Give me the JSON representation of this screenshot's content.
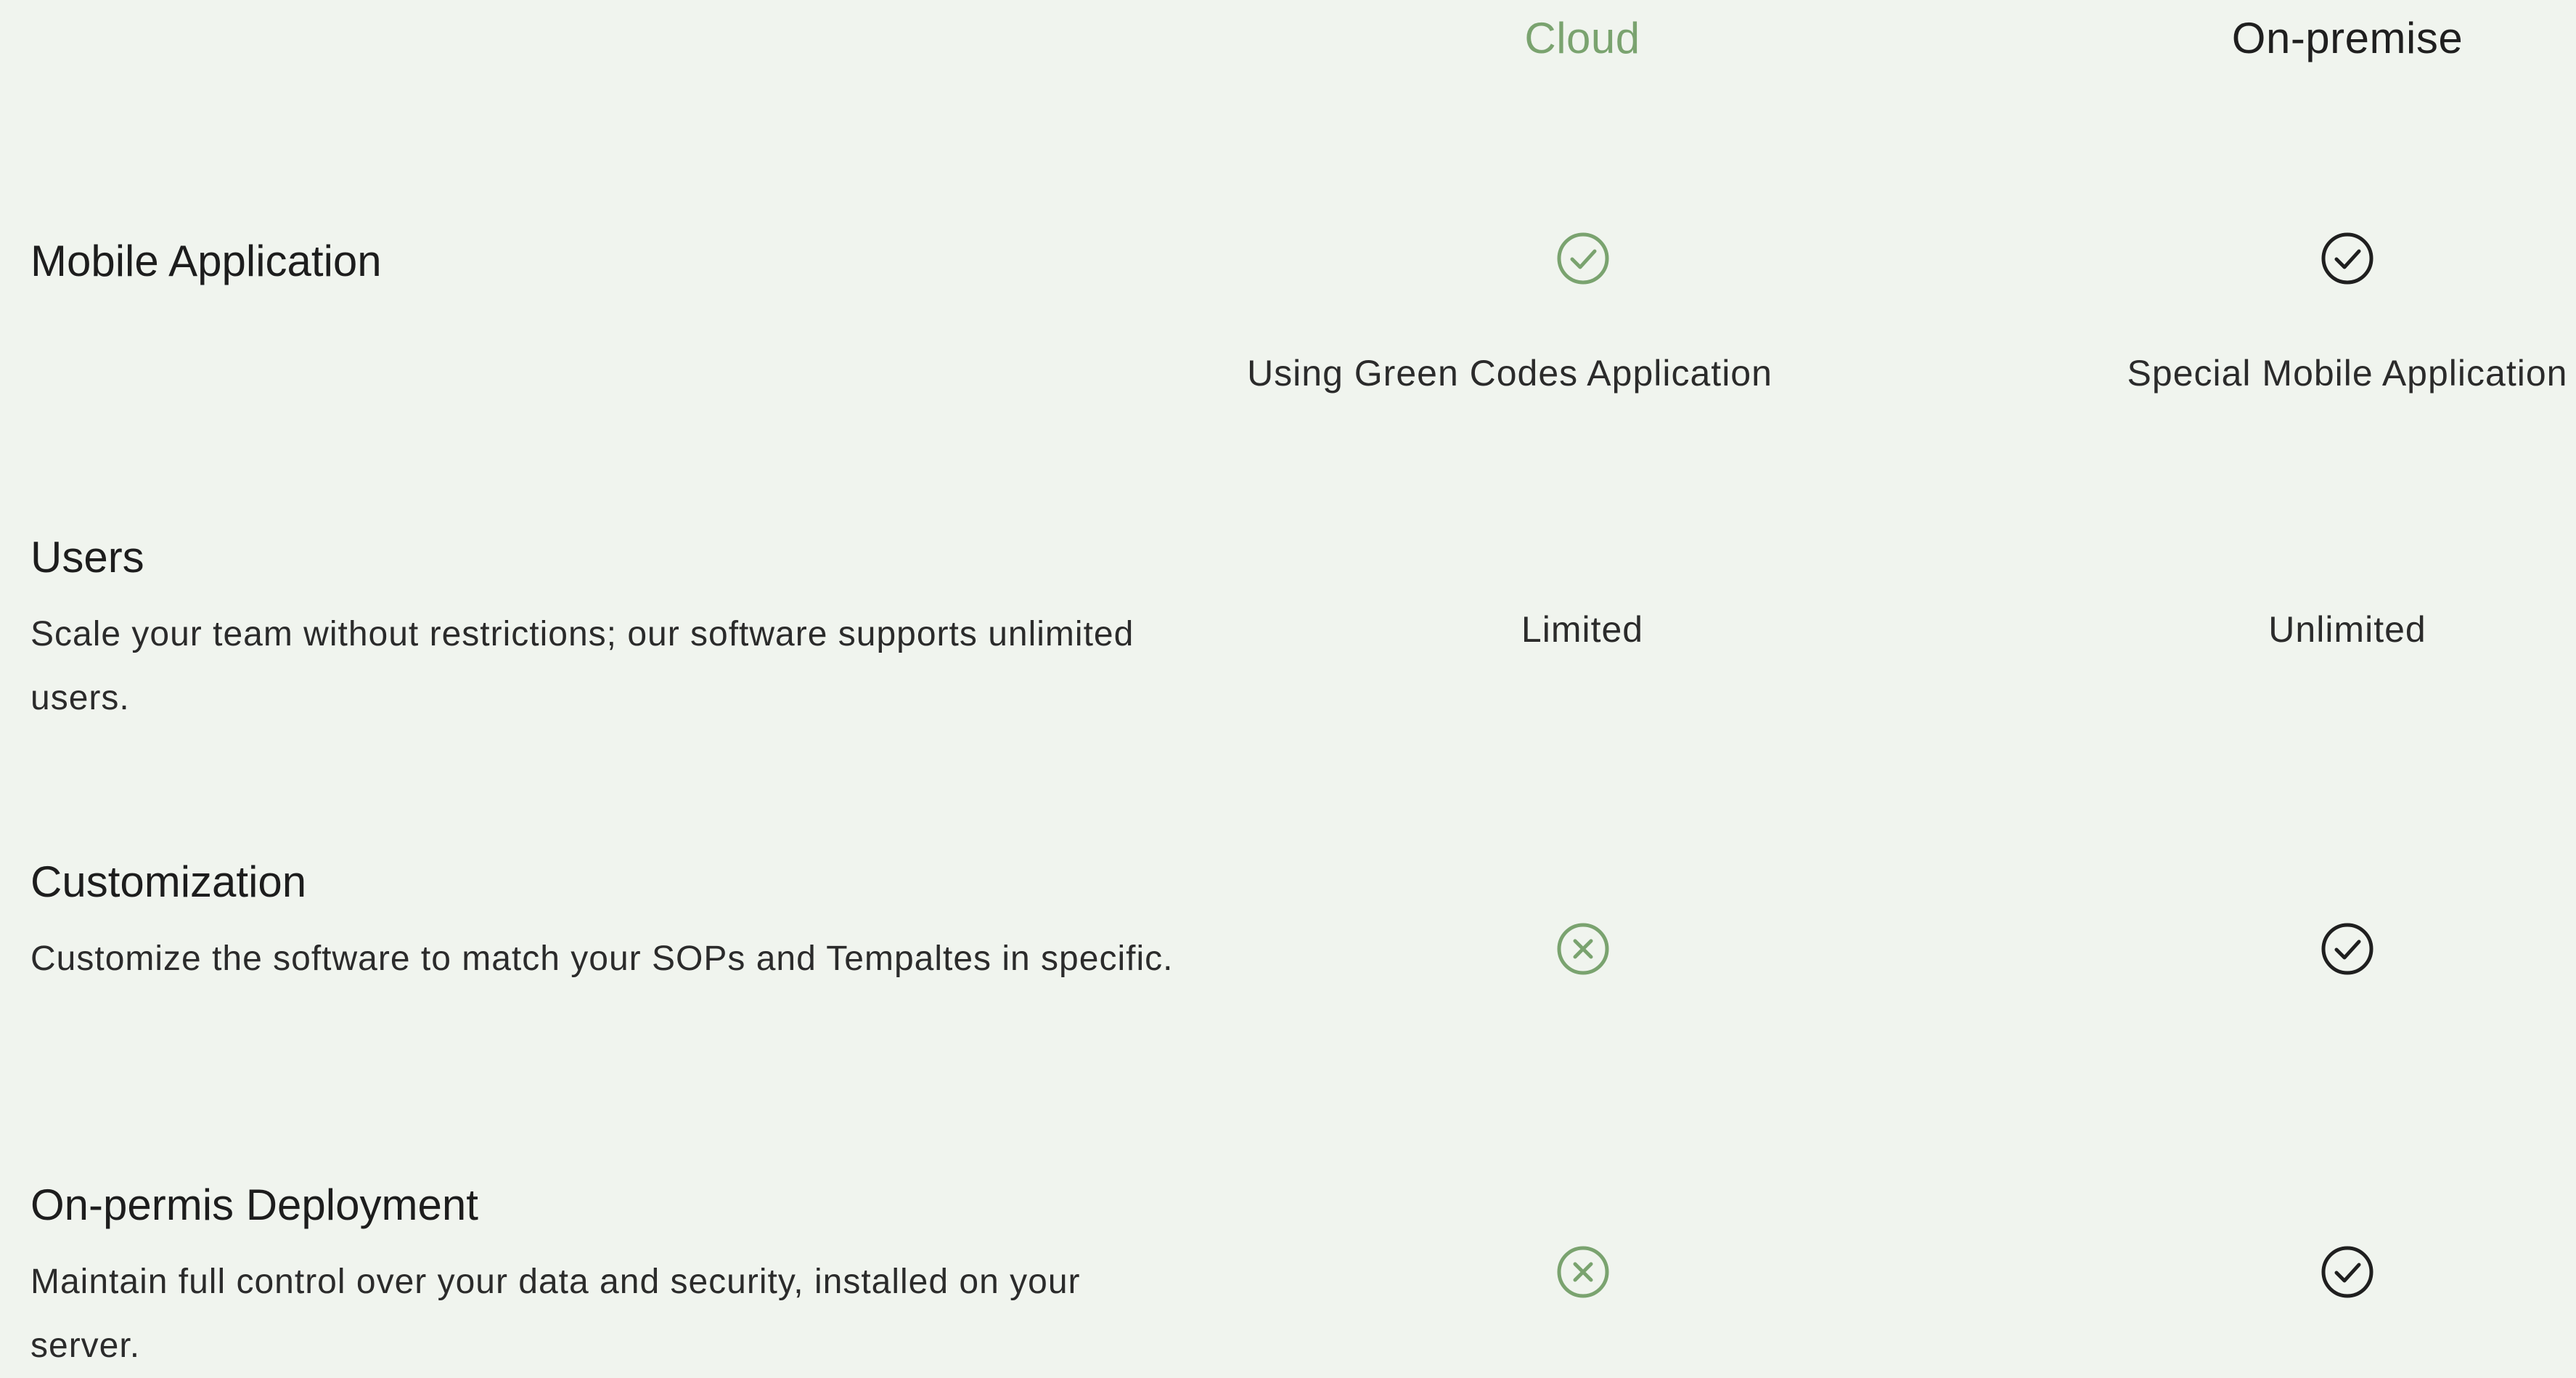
{
  "columns": {
    "cloud": "Cloud",
    "onpremise": "On-premise"
  },
  "colors": {
    "accent": "#7aa36f",
    "text": "#1d1d1d",
    "background": "#f0f4ee"
  },
  "rows": [
    {
      "title": "Mobile Application",
      "description": "",
      "cloud_icon": "check-circle-icon",
      "onprem_icon": "check-circle-icon",
      "cloud_text": "Using Green Codes Application",
      "onprem_text": "Special Mobile Application"
    },
    {
      "title": "Users",
      "description": "Scale your team without restrictions; our software supports unlimited users.",
      "cloud_text": "Limited",
      "onprem_text": "Unlimited"
    },
    {
      "title": "Customization",
      "description": "Customize the software to match your SOPs and Tempaltes in specific.",
      "cloud_icon": "x-circle-icon",
      "onprem_icon": "check-circle-icon"
    },
    {
      "title": "On-permis Deployment",
      "description": "Maintain full control over your data and security, installed on your server.",
      "cloud_icon": "x-circle-icon",
      "onprem_icon": "check-circle-icon"
    }
  ]
}
